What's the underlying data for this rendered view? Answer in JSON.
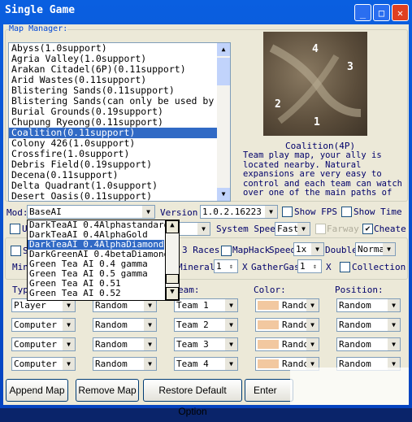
{
  "window": {
    "title": "Single Game",
    "minimize": "_",
    "maximize": "□",
    "close": "✕"
  },
  "map_manager": {
    "label": "Map Manager:",
    "maps": [
      "Abyss(1.0support)",
      "Agria Valley(1.0support)",
      "Arakan Citadel(6P)(0.11support)",
      "Arid Wastes(0.11support)",
      "Blistering Sands(0.11support)",
      "Blistering Sands(can only be used by",
      "Burial Grounds(0.19support)",
      "Chupung Ryeong(0.11support)",
      "Coalition(0.11support)",
      "Colony 426(1.0support)",
      "Crossfire(1.0support)",
      "Debris Field(0.19support)",
      "Decena(0.11support)",
      "Delta Quadrant(1.0support)",
      "Desert Oasis(0.11support)"
    ],
    "selected": "Coalition(0.11support)",
    "preview_numbers": [
      "4",
      "3",
      "2",
      "1"
    ],
    "preview_caption": "Coalition(4P)",
    "description": [
      "Team play map, your ally is",
      "located nearby. Natural",
      "expansions are very easy to",
      "control and each team can watch",
      "over one of the main paths of"
    ]
  },
  "options": {
    "mod_label": "Mod:",
    "mod_value": "BaseAI",
    "version_label": "Version:",
    "version_value": "1.0.2.16223",
    "show_fps": "Show FPS",
    "show_time": "Show Time",
    "u_label": "U",
    "d_value": "d",
    "system_speed_label": "System Speed",
    "system_speed_value": "Fast",
    "farway": "Farway",
    "cheate": "Cheate",
    "cheate_checked": true,
    "s_label": "S",
    "races": "3 Races",
    "maphack": "MapHack",
    "speed_label": "Speed",
    "speed_value": "1x",
    "double_label": "Double",
    "double_value": "Normal",
    "min_label": "Min",
    "minerals_label": "Minerals",
    "minerals_value": "1",
    "x1": "X",
    "gathergas_label": "GatherGas",
    "gathergas_value": "1",
    "x2": "X",
    "collection": "Collection"
  },
  "mod_dropdown": {
    "items": [
      "DarkTeaAI 0.4Alphastandard",
      "DarkTeaAI 0.4AlphaGold",
      "DarkTeaAI 0.4AlphaDiamond",
      "DarkGreenAI 0.4betaDiamond",
      "Green Tea AI 0.4 gamma",
      "Green Tea AI 0.5 gamma",
      "Green Tea AI 0.51",
      "Green Tea AI 0.52"
    ],
    "highlighted": "DarkTeaAI 0.4AlphaDiamond"
  },
  "players": {
    "headers": {
      "type": "Typ",
      "team": "eam:",
      "color": "Color:",
      "position": "Position:"
    },
    "rows": [
      {
        "type": "Player",
        "race": "Random",
        "team": "Team 1",
        "color": "Rando",
        "position": "Random"
      },
      {
        "type": "Computer",
        "race": "Random",
        "team": "Team 2",
        "color": "Rando",
        "position": "Random"
      },
      {
        "type": "Computer",
        "race": "Random",
        "team": "Team 3",
        "color": "Rando",
        "position": "Random"
      },
      {
        "type": "Computer",
        "race": "Random",
        "team": "Team 4",
        "color": "Rando",
        "position": "Random"
      }
    ]
  },
  "buttons": {
    "append": "Append Map",
    "remove": "Remove Map",
    "restore": "Restore Default  Option",
    "enter": "Enter"
  },
  "colors": {
    "titlebar": "#0a5fe0",
    "selection": "#316ac5",
    "dialog": "#ece9d8",
    "player_color": "#f2c8a0"
  }
}
